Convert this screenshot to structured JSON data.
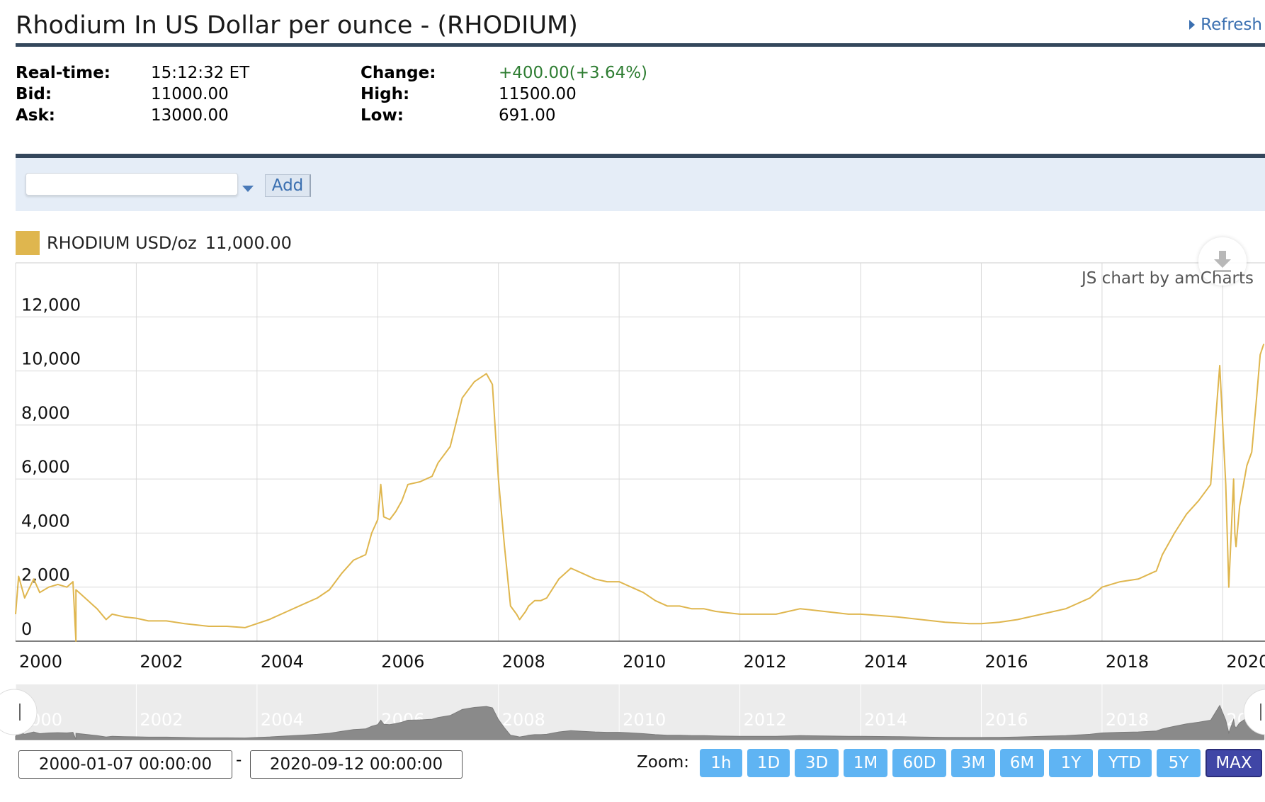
{
  "header": {
    "title": "Rhodium In US Dollar per ounce - (RHODIUM)",
    "refresh_label": "Refresh"
  },
  "quote": {
    "realtime_label": "Real-time:",
    "realtime_value": "15:12:32 ET",
    "bid_label": "Bid:",
    "bid_value": "11000.00",
    "ask_label": "Ask:",
    "ask_value": "13000.00",
    "change_label": "Change:",
    "change_value": "+400.00(+3.64%)",
    "high_label": "High:",
    "high_value": "11500.00",
    "low_label": "Low:",
    "low_value": "691.00"
  },
  "compare": {
    "input_value": "",
    "add_label": "Add"
  },
  "legend": {
    "name": "RHODIUM USD/oz",
    "value": "11,000.00"
  },
  "credit": "JS chart by amCharts",
  "colors": {
    "series": "#dfb64e",
    "header_rule": "#34475c",
    "zoom_button": "#5fb4f3",
    "zoom_active": "#4046a6",
    "change_positive": "#2e7d32"
  },
  "range": {
    "from": "2000-01-07 00:00:00",
    "separator": "-",
    "to": "2020-09-12 00:00:00"
  },
  "zoom": {
    "label": "Zoom:",
    "buttons": [
      "1h",
      "1D",
      "3D",
      "1M",
      "60D",
      "3M",
      "6M",
      "1Y",
      "YTD",
      "5Y",
      "MAX"
    ],
    "active": "MAX"
  },
  "chart_data": {
    "type": "line",
    "title": "",
    "xlabel": "",
    "ylabel": "",
    "x_ticks": [
      "2000",
      "2002",
      "2004",
      "2006",
      "2008",
      "2010",
      "2012",
      "2014",
      "2016",
      "2018",
      "2020"
    ],
    "y_ticks": [
      "0",
      "2,000",
      "4,000",
      "6,000",
      "8,000",
      "10,000",
      "12,000"
    ],
    "ylim": [
      0,
      14000
    ],
    "xlim": [
      2000.0,
      2020.7
    ],
    "grid": true,
    "series": [
      {
        "name": "RHODIUM USD/oz",
        "x": [
          2000.0,
          2000.05,
          2000.15,
          2000.3,
          2000.4,
          2000.55,
          2000.7,
          2000.85,
          2000.95,
          2001.0,
          2001.0,
          2001.05,
          2001.2,
          2001.35,
          2001.5,
          2001.6,
          2001.8,
          2002.0,
          2002.2,
          2002.5,
          2002.8,
          2003.0,
          2003.2,
          2003.5,
          2003.8,
          2004.0,
          2004.2,
          2004.5,
          2004.8,
          2005.0,
          2005.2,
          2005.4,
          2005.6,
          2005.8,
          2005.9,
          2006.0,
          2006.05,
          2006.1,
          2006.2,
          2006.3,
          2006.4,
          2006.5,
          2006.7,
          2006.9,
          2007.0,
          2007.2,
          2007.4,
          2007.6,
          2007.8,
          2007.9,
          2008.0,
          2008.1,
          2008.2,
          2008.3,
          2008.35,
          2008.4,
          2008.45,
          2008.5,
          2008.6,
          2008.7,
          2008.8,
          2009.0,
          2009.2,
          2009.4,
          2009.6,
          2009.8,
          2009.9,
          2010.0,
          2010.2,
          2010.4,
          2010.6,
          2010.8,
          2011.0,
          2011.2,
          2011.4,
          2011.6,
          2011.8,
          2012.0,
          2012.3,
          2012.6,
          2013.0,
          2013.4,
          2013.8,
          2014.0,
          2014.3,
          2014.6,
          2015.0,
          2015.4,
          2015.8,
          2016.0,
          2016.3,
          2016.6,
          2017.0,
          2017.4,
          2017.8,
          2018.0,
          2018.3,
          2018.6,
          2018.9,
          2019.0,
          2019.2,
          2019.4,
          2019.6,
          2019.8,
          2019.95,
          2020.05,
          2020.1,
          2020.18,
          2020.2,
          2020.22,
          2020.28,
          2020.32,
          2020.36,
          2020.4,
          2020.48,
          2020.56,
          2020.62,
          2020.68
        ],
        "y": [
          1000,
          2400,
          1600,
          2300,
          1800,
          2000,
          2100,
          2000,
          2200,
          0,
          1900,
          1800,
          1500,
          1200,
          800,
          1000,
          900,
          850,
          750,
          750,
          650,
          600,
          550,
          550,
          500,
          650,
          800,
          1100,
          1400,
          1600,
          1900,
          2500,
          3000,
          3200,
          4000,
          4500,
          5800,
          4600,
          4500,
          4800,
          5200,
          5800,
          5900,
          6100,
          6600,
          7200,
          9000,
          9600,
          9900,
          9500,
          6000,
          3500,
          1300,
          1000,
          800,
          950,
          1100,
          1300,
          1500,
          1500,
          1600,
          2300,
          2700,
          2500,
          2300,
          2200,
          2200,
          2200,
          2000,
          1800,
          1500,
          1300,
          1300,
          1200,
          1200,
          1100,
          1050,
          1000,
          1000,
          1000,
          1200,
          1100,
          1000,
          1000,
          950,
          900,
          800,
          700,
          650,
          650,
          700,
          800,
          1000,
          1200,
          1600,
          2000,
          2200,
          2300,
          2600,
          3200,
          4000,
          4700,
          5200,
          5800,
          10200,
          5800,
          2000,
          6000,
          4000,
          3500,
          5000,
          5500,
          6000,
          6500,
          7000,
          9000,
          10600,
          11000
        ]
      }
    ]
  }
}
